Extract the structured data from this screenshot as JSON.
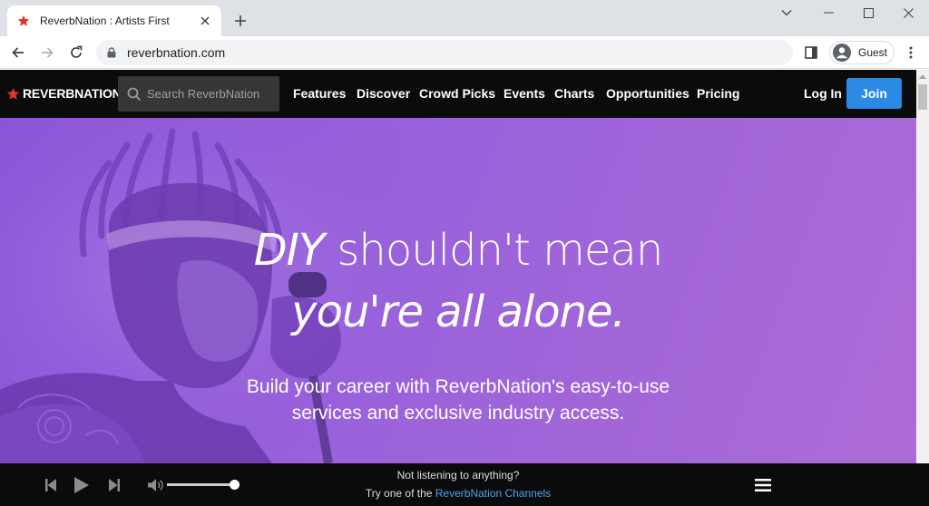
{
  "browser": {
    "tab_title": "ReverbNation : Artists First",
    "url": "reverbnation.com",
    "profile_name": "Guest"
  },
  "header": {
    "logo_text": "REVERBNATION",
    "logo_tm": "™",
    "search_placeholder": "Search ReverbNation",
    "nav": [
      "Features",
      "Discover",
      "Crowd Picks",
      "Events",
      "Charts",
      "Opportunities",
      "Pricing"
    ],
    "login_label": "Log In",
    "join_label": "Join"
  },
  "hero": {
    "line1_em": "DIY",
    "line1_rest": " shouldn't mean",
    "line2": "you're all alone.",
    "sub1": "Build your career with ReverbNation's easy-to-use",
    "sub2": "services and exclusive industry access."
  },
  "player": {
    "status": "Not listening to anything?",
    "cta_prefix": "Try one of the ",
    "cta_link": "ReverbNation Channels",
    "volume_fraction": 0.93
  },
  "colors": {
    "accent_blue": "#2a8ae4",
    "brand_red": "#e5332a",
    "hero_purple": "#9a62db"
  }
}
